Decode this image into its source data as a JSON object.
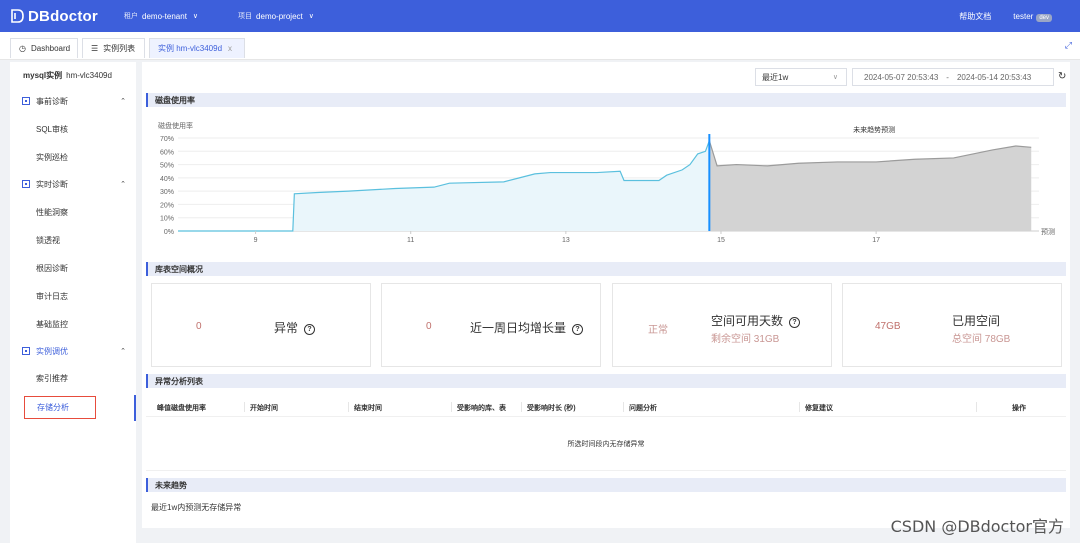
{
  "app": {
    "name": "DBdoctor"
  },
  "topbar": {
    "tenant_key": "租户",
    "tenant_value": "demo-tenant",
    "project_key": "项目",
    "project_value": "demo-project",
    "help": "帮助文档",
    "user": "tester",
    "env": "dev"
  },
  "tabs": [
    {
      "label": "Dashboard",
      "icon": "dashboard-icon"
    },
    {
      "label": "实例列表",
      "icon": "list-icon"
    },
    {
      "label": "实例 hm-vlc3409d",
      "icon": "close-icon",
      "close": "x"
    }
  ],
  "sidebar": {
    "title_type": "mysql实例",
    "title_id": "hm-vlc3409d",
    "groups": [
      {
        "label": "事前诊断",
        "items": [
          "SQL审核",
          "实例巡检"
        ]
      },
      {
        "label": "实时诊断",
        "items": [
          "性能洞察",
          "锁透视",
          "根因诊断",
          "审计日志",
          "基础监控"
        ]
      },
      {
        "label": "实例调优",
        "items": [
          "索引推荐",
          "存储分析"
        ]
      }
    ],
    "active_item": "存储分析"
  },
  "toolbar": {
    "range": "最近1w",
    "start": "2024-05-07 20:53:43",
    "sep": "-",
    "end": "2024-05-14 20:53:43"
  },
  "sections": {
    "disk_usage": "磁盘使用率",
    "overview": "库表空间概况",
    "anomaly_list": "异常分析列表",
    "future_trend": "未来趋势"
  },
  "chart_data": {
    "type": "area",
    "title": "",
    "ylabel": "磁盘使用率",
    "annotation": "未来趋势预测",
    "ylim": [
      0,
      70
    ],
    "y_ticks": [
      "0%",
      "10%",
      "20%",
      "30%",
      "40%",
      "50%",
      "60%",
      "70%"
    ],
    "x_ticks": [
      {
        "x": 9,
        "label": "9"
      },
      {
        "x": 11,
        "label": "11"
      },
      {
        "x": 13,
        "label": "13"
      },
      {
        "x": 15,
        "label": "15"
      },
      {
        "x": 17,
        "label": "17"
      }
    ],
    "x_end_label": "预测",
    "xlim": [
      8,
      19.1
    ],
    "split_x": 14.85,
    "series": [
      {
        "name": "actual",
        "color": "#5bc0de",
        "points": [
          [
            8,
            0
          ],
          [
            9.48,
            0
          ],
          [
            9.5,
            28
          ],
          [
            9.8,
            29
          ],
          [
            10.2,
            30
          ],
          [
            10.8,
            32
          ],
          [
            11.3,
            33
          ],
          [
            11.5,
            36
          ],
          [
            12.2,
            37
          ],
          [
            12.4,
            40
          ],
          [
            12.6,
            43
          ],
          [
            12.8,
            44
          ],
          [
            13.4,
            44
          ],
          [
            13.7,
            45
          ],
          [
            13.75,
            38
          ],
          [
            14.2,
            38
          ],
          [
            14.3,
            42
          ],
          [
            14.5,
            46
          ],
          [
            14.6,
            50
          ],
          [
            14.7,
            58
          ],
          [
            14.8,
            60
          ],
          [
            14.85,
            68
          ]
        ]
      },
      {
        "name": "forecast",
        "color": "#9b9b9b",
        "points": [
          [
            14.85,
            68
          ],
          [
            14.95,
            49
          ],
          [
            15.2,
            50
          ],
          [
            15.6,
            49
          ],
          [
            16.0,
            51
          ],
          [
            16.5,
            52
          ],
          [
            17.0,
            52
          ],
          [
            17.5,
            54
          ],
          [
            18.0,
            55
          ],
          [
            18.5,
            61
          ],
          [
            18.8,
            64
          ],
          [
            19.0,
            63
          ]
        ]
      }
    ]
  },
  "cards": [
    {
      "value": "0",
      "label": "异常"
    },
    {
      "value": "0",
      "label": "近一周日均增长量"
    },
    {
      "value": "正常",
      "label": "空间可用天数",
      "sub": "剩余空间 31GB"
    },
    {
      "value": "47GB",
      "label": "已用空间",
      "sub": "总空间 78GB"
    }
  ],
  "table": {
    "columns": [
      "峰值磁盘使用率",
      "开始时间",
      "结束时间",
      "受影响的库、表",
      "受影响时长 (秒)",
      "问题分析",
      "修复建议",
      "操作"
    ],
    "empty_text": "所选时间段内无存储异常"
  },
  "future_text": "最近1w内预测无存储异常",
  "watermark": "CSDN @DBdoctor官方",
  "colors": {
    "brand": "#3d5fdb",
    "highlight": "#e74c3c"
  }
}
